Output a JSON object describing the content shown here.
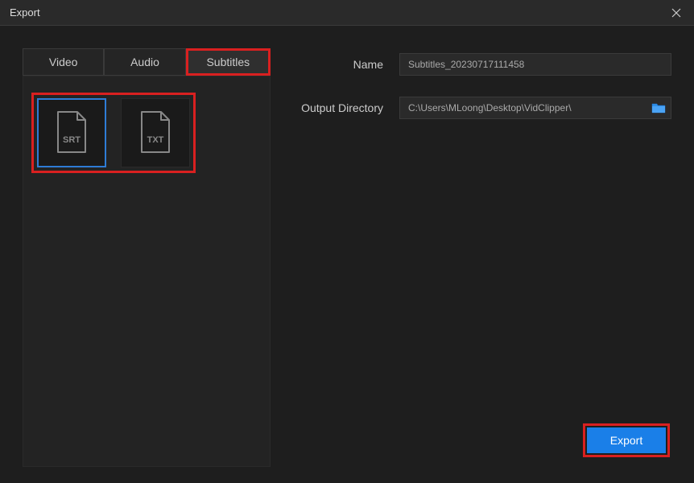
{
  "titlebar": {
    "title": "Export"
  },
  "tabs": [
    {
      "label": "Video",
      "active": false
    },
    {
      "label": "Audio",
      "active": false
    },
    {
      "label": "Subtitles",
      "active": true
    }
  ],
  "formats": [
    {
      "name": "SRT",
      "selected": true
    },
    {
      "name": "TXT",
      "selected": false
    }
  ],
  "form": {
    "name_label": "Name",
    "name_value": "Subtitles_20230717111458",
    "directory_label": "Output Directory",
    "directory_value": "C:\\Users\\MLoong\\Desktop\\VidClipper\\"
  },
  "buttons": {
    "export_label": "Export"
  }
}
